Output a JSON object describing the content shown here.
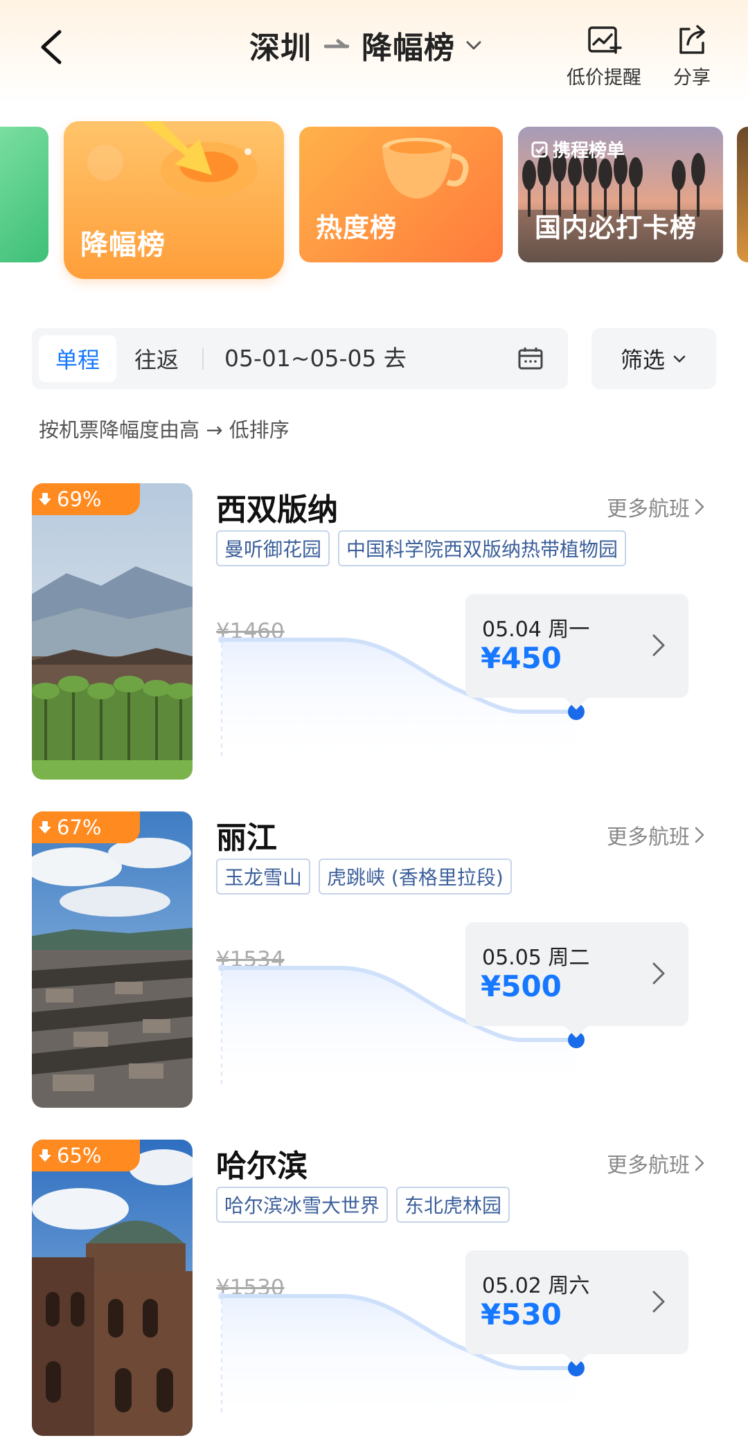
{
  "header": {
    "origin": "深圳",
    "list_name": "降幅榜",
    "alert_label": "低价提醒",
    "share_label": "分享"
  },
  "rank_cards": [
    {
      "label": "降幅榜",
      "active": true
    },
    {
      "label": "热度榜"
    },
    {
      "label": "国内必打卡榜",
      "brand": "携程榜单"
    }
  ],
  "filter": {
    "oneway": "单程",
    "roundtrip": "往返",
    "date_range": "05-01~05-05 去",
    "filter_label": "筛选"
  },
  "sort_note": "按机票降幅度由高 → 低排序",
  "destinations": [
    {
      "drop": "69%",
      "name": "西双版纳",
      "more": "更多航班",
      "tags": [
        "曼听御花园",
        "中国科学院西双版纳热带植物园"
      ],
      "old_price": "¥1460",
      "date": "05.04 周一",
      "price": "¥450"
    },
    {
      "drop": "67%",
      "name": "丽江",
      "more": "更多航班",
      "tags": [
        "玉龙雪山",
        "虎跳峡 (香格里拉段)"
      ],
      "old_price": "¥1534",
      "date": "05.05 周二",
      "price": "¥500"
    },
    {
      "drop": "65%",
      "name": "哈尔滨",
      "more": "更多航班",
      "tags": [
        "哈尔滨冰雪大世界",
        "东北虎林园"
      ],
      "old_price": "¥1530",
      "date": "05.02 周六",
      "price": "¥530"
    }
  ],
  "colors": {
    "accent": "#1677ff",
    "badge": "#ff8a1f",
    "tag_border": "#c6d4e9",
    "tag_text": "#3b5f9a"
  }
}
